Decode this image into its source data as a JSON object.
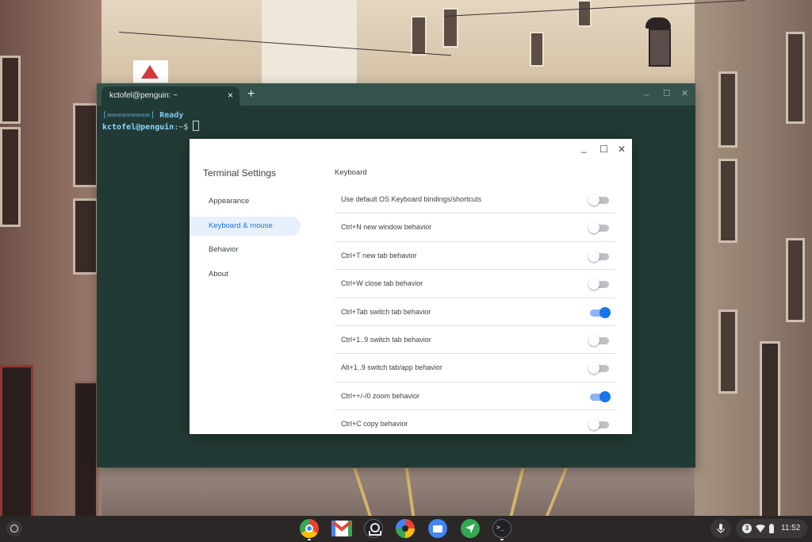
{
  "terminal": {
    "tab_title": "kctofel@penguin: ~",
    "tab_close": "×",
    "new_tab": "+",
    "minimize": "_",
    "maximize": "☐",
    "close": "✕",
    "line1_progress": "[=========]",
    "line1_status": "Ready",
    "prompt_user": "kctofel@penguin",
    "prompt_path": ":~$"
  },
  "settings": {
    "title": "Terminal Settings",
    "minimize": "_",
    "maximize": "☐",
    "close": "✕",
    "nav": [
      {
        "label": "Appearance",
        "active": false
      },
      {
        "label": "Keyboard & mouse",
        "active": true
      },
      {
        "label": "Behavior",
        "active": false
      },
      {
        "label": "About",
        "active": false
      }
    ],
    "section_title": "Keyboard",
    "options": [
      {
        "label": "Use default OS Keyboard bindings/shortcuts",
        "on": false
      },
      {
        "label": "Ctrl+N new window behavior",
        "on": false
      },
      {
        "label": "Ctrl+T new tab behavior",
        "on": false
      },
      {
        "label": "Ctrl+W close tab behavior",
        "on": false
      },
      {
        "label": "Ctrl+Tab switch tab behavior",
        "on": true
      },
      {
        "label": "Ctrl+1..9 switch tab behavior",
        "on": false
      },
      {
        "label": "Alt+1..9 switch tab/app behavior",
        "on": false
      },
      {
        "label": "Ctrl++/-/0 zoom behavior",
        "on": true
      },
      {
        "label": "Ctrl+C copy behavior",
        "on": false
      }
    ]
  },
  "shelf": {
    "apps": [
      "chrome-icon",
      "gmail-icon",
      "app-icon",
      "photos-icon",
      "files-icon",
      "send-icon",
      "terminal-icon"
    ],
    "terminal_glyph": ">_",
    "notification_count": "3",
    "time": "11:52"
  },
  "colors": {
    "accent": "#1a73e8",
    "terminal_bg": "#223a35",
    "terminal_titlebar": "#34534c",
    "shelf_bg": "#2b2727"
  }
}
